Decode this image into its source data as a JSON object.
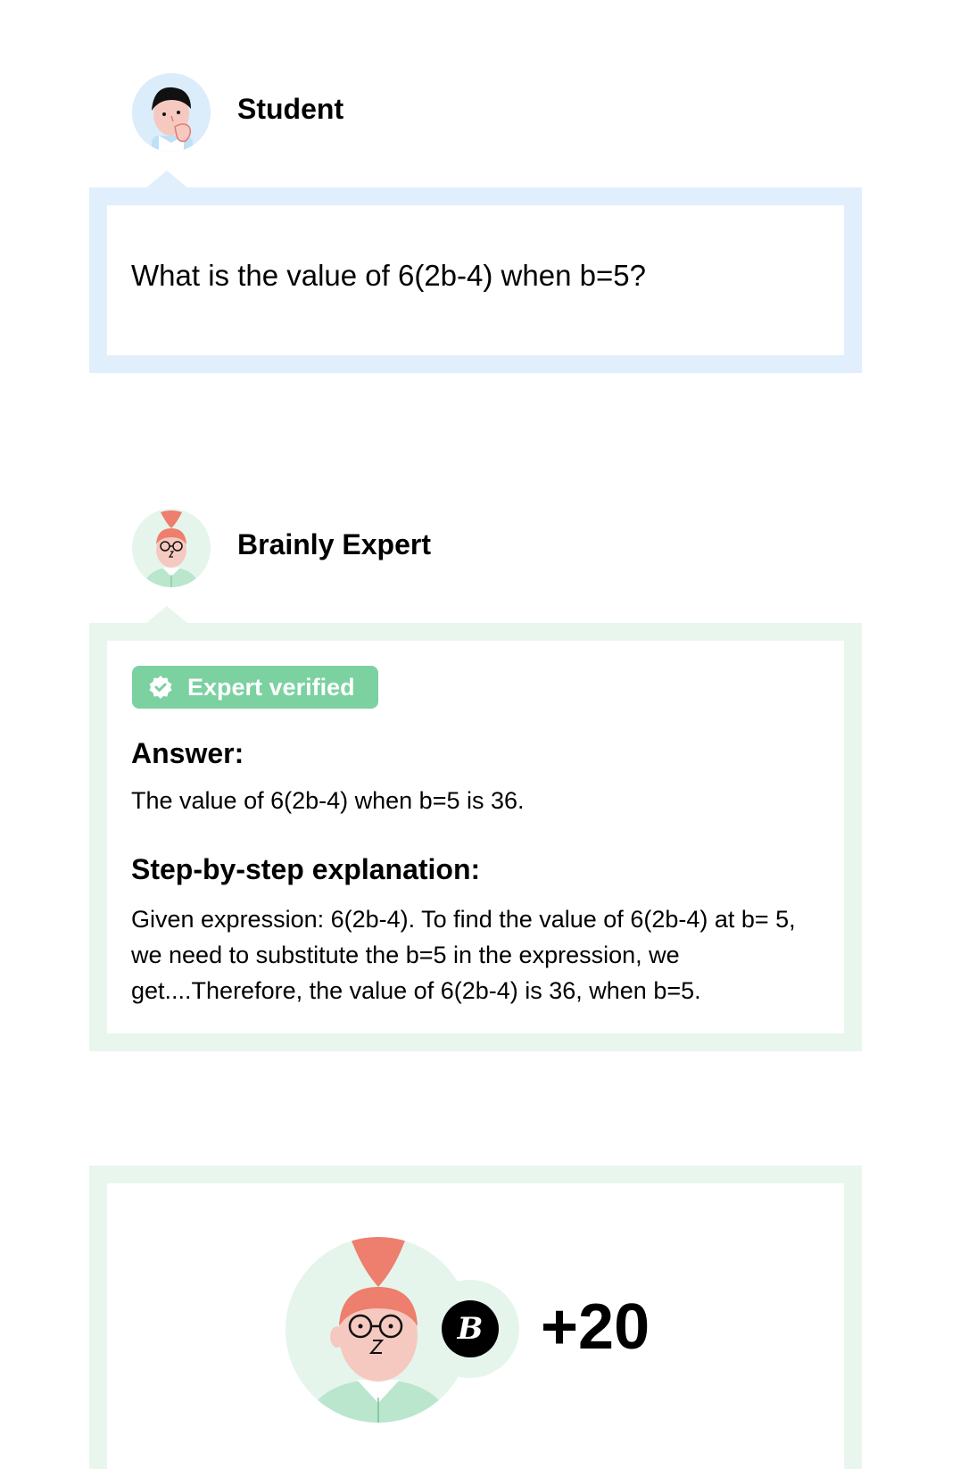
{
  "student": {
    "name": "Student"
  },
  "question": {
    "text": "What is the value of 6(2b-4) when b=5?"
  },
  "expert": {
    "name": "Brainly Expert"
  },
  "answer": {
    "badge": "Expert verified",
    "answer_heading": "Answer:",
    "answer_text": "The value of 6(2b-4) when b=5 is 36.",
    "steps_heading": "Step-by-step explanation:",
    "steps_text": "Given expression: 6(2b-4). To find the value of 6(2b-4) at b= 5, we need to substitute the b=5 in the expression, we get....Therefore, the value of 6(2b-4) is 36, when b=5."
  },
  "reward": {
    "coin_letter": "B",
    "points": "+20"
  },
  "colors": {
    "student_accent": "#e1effd",
    "expert_accent": "#e8f6ee",
    "badge_green": "#7bd1a0",
    "hair_coral": "#ee7e6e",
    "skin": "#f6c9c0"
  },
  "icons": {
    "student_avatar": "student-avatar-icon",
    "expert_avatar": "expert-avatar-icon",
    "verified": "verified-check-icon",
    "coin": "brainly-coin-icon"
  }
}
